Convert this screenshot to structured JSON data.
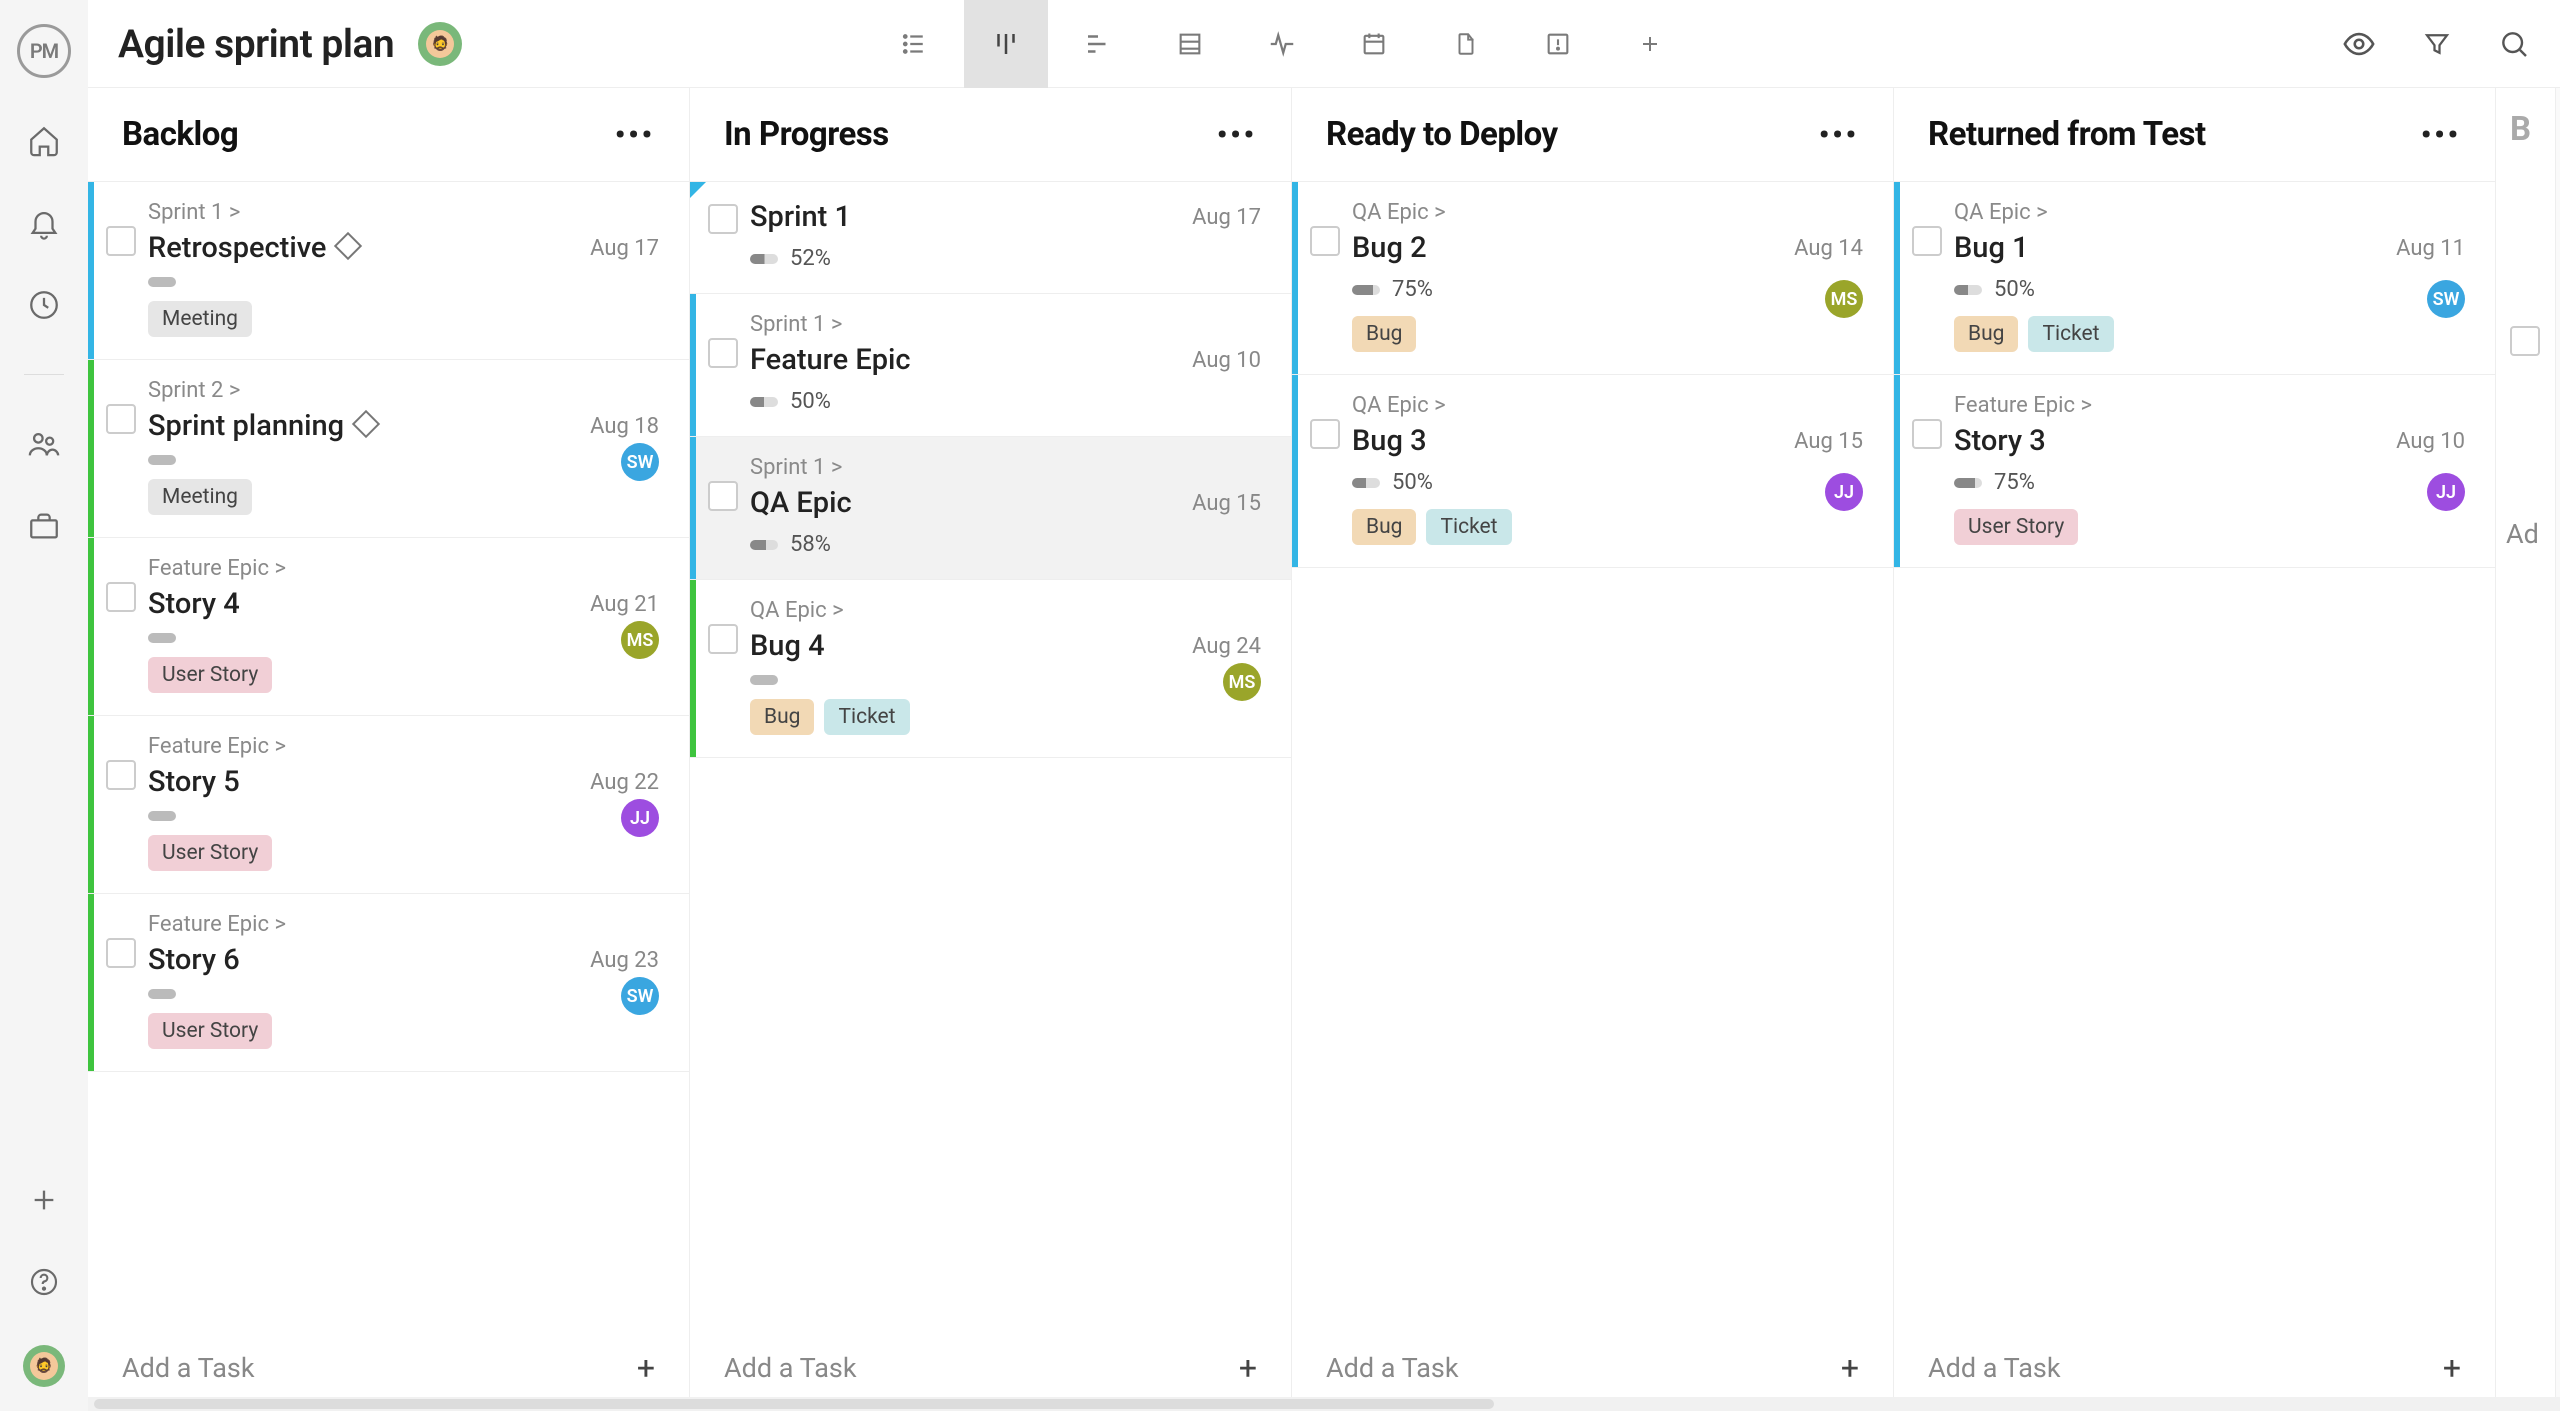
{
  "app": {
    "logo_text": "PM"
  },
  "header": {
    "title": "Agile sprint plan",
    "views": {
      "active_index": 1
    }
  },
  "add_task_label": "Add a Task",
  "columns": [
    {
      "title": "Backlog",
      "cards": [
        {
          "breadcrumb": "Sprint 1 >",
          "title": "Retrospective",
          "milestone": true,
          "date": "Aug 17",
          "progress": null,
          "tags": [
            "Meeting"
          ],
          "stripe": "blue",
          "assignee": null
        },
        {
          "breadcrumb": "Sprint 2 >",
          "title": "Sprint planning",
          "milestone": true,
          "date": "Aug 18",
          "progress": null,
          "tags": [
            "Meeting"
          ],
          "stripe": "green",
          "assignee": "SW"
        },
        {
          "breadcrumb": "Feature Epic >",
          "title": "Story 4",
          "milestone": false,
          "date": "Aug 21",
          "progress": null,
          "tags": [
            "User Story"
          ],
          "stripe": "green",
          "assignee": "MS"
        },
        {
          "breadcrumb": "Feature Epic >",
          "title": "Story 5",
          "milestone": false,
          "date": "Aug 22",
          "progress": null,
          "tags": [
            "User Story"
          ],
          "stripe": "green",
          "assignee": "JJ"
        },
        {
          "breadcrumb": "Feature Epic >",
          "title": "Story 6",
          "milestone": false,
          "date": "Aug 23",
          "progress": null,
          "tags": [
            "User Story"
          ],
          "stripe": "green",
          "assignee": "SW"
        }
      ]
    },
    {
      "title": "In Progress",
      "cards": [
        {
          "breadcrumb": null,
          "title": "Sprint 1",
          "milestone": false,
          "date": "Aug 17",
          "progress": "52%",
          "tags": [],
          "stripe": "corner",
          "assignee": null
        },
        {
          "breadcrumb": "Sprint 1 >",
          "title": "Feature Epic",
          "milestone": false,
          "date": "Aug 10",
          "progress": "50%",
          "tags": [],
          "stripe": "blue",
          "assignee": null
        },
        {
          "breadcrumb": "Sprint 1 >",
          "title": "QA Epic",
          "milestone": false,
          "date": "Aug 15",
          "progress": "58%",
          "tags": [],
          "stripe": "blue",
          "assignee": null,
          "selected": true
        },
        {
          "breadcrumb": "QA Epic >",
          "title": "Bug 4",
          "milestone": false,
          "date": "Aug 24",
          "progress": null,
          "tags": [
            "Bug",
            "Ticket"
          ],
          "stripe": "green",
          "assignee": "MS"
        }
      ]
    },
    {
      "title": "Ready to Deploy",
      "cards": [
        {
          "breadcrumb": "QA Epic >",
          "title": "Bug 2",
          "milestone": false,
          "date": "Aug 14",
          "progress": "75%",
          "tags": [
            "Bug"
          ],
          "stripe": "blue",
          "assignee": "MS"
        },
        {
          "breadcrumb": "QA Epic >",
          "title": "Bug 3",
          "milestone": false,
          "date": "Aug 15",
          "progress": "50%",
          "tags": [
            "Bug",
            "Ticket"
          ],
          "stripe": "blue",
          "assignee": "JJ"
        }
      ]
    },
    {
      "title": "Returned from Test",
      "cards": [
        {
          "breadcrumb": "QA Epic >",
          "title": "Bug 1",
          "milestone": false,
          "date": "Aug 11",
          "progress": "50%",
          "tags": [
            "Bug",
            "Ticket"
          ],
          "stripe": "blue",
          "assignee": "SW"
        },
        {
          "breadcrumb": "Feature Epic >",
          "title": "Story 3",
          "milestone": false,
          "date": "Aug 10",
          "progress": "75%",
          "tags": [
            "User Story"
          ],
          "stripe": "blue",
          "assignee": "JJ"
        }
      ]
    }
  ],
  "peek_column": {
    "title_fragment": "B",
    "add_fragment": "Ad"
  },
  "tag_labels": {
    "Meeting": "Meeting",
    "User Story": "User Story",
    "Bug": "Bug",
    "Ticket": "Ticket"
  },
  "assignees": {
    "SW": "SW",
    "MS": "MS",
    "JJ": "JJ"
  }
}
